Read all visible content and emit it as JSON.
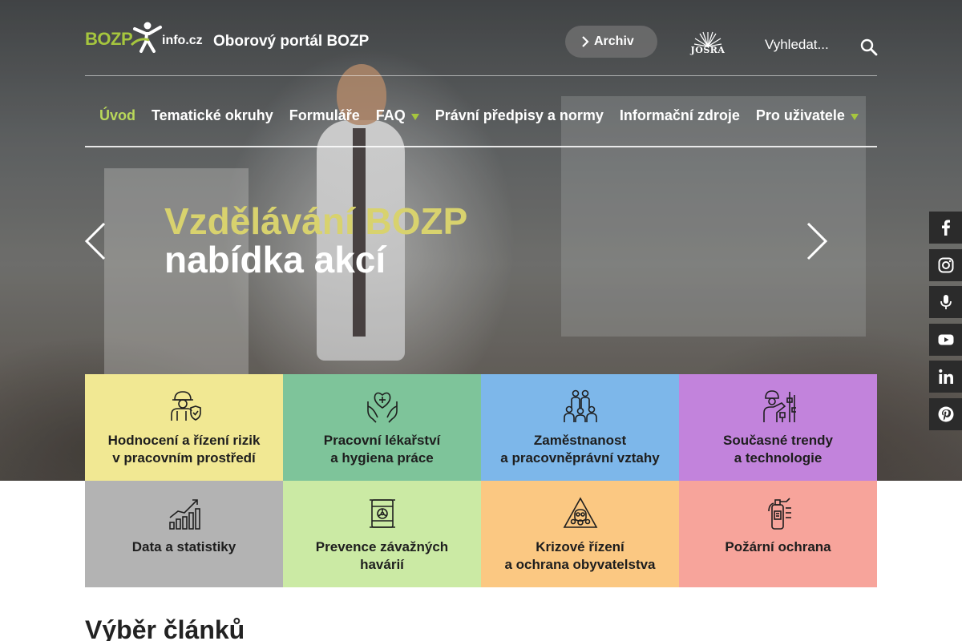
{
  "header": {
    "logo_text_main": "BOZP",
    "logo_text_domain": "info.cz",
    "portal_title": "Oborový portál BOZP",
    "archiv_label": "Archiv",
    "partner_logo_text": "JOSRA",
    "search_placeholder": "Vyhledat...",
    "accent_color": "#a6c63e"
  },
  "nav": {
    "items": [
      {
        "label": "Úvod",
        "active": true,
        "has_dropdown": false
      },
      {
        "label": "Tematické okruhy",
        "active": false,
        "has_dropdown": false
      },
      {
        "label": "Formuláře",
        "active": false,
        "has_dropdown": false
      },
      {
        "label": "FAQ",
        "active": false,
        "has_dropdown": true
      },
      {
        "label": "Právní předpisy a normy",
        "active": false,
        "has_dropdown": false
      },
      {
        "label": "Informační zdroje",
        "active": false,
        "has_dropdown": false
      },
      {
        "label": "Pro uživatele",
        "active": false,
        "has_dropdown": true
      }
    ]
  },
  "slider": {
    "title": "Vzdělávání BOZP",
    "subtitle": "nabídka akcí",
    "title_color": "#d8d26e"
  },
  "social": [
    "facebook-icon",
    "instagram-icon",
    "microphone-icon",
    "youtube-icon",
    "linkedin-icon",
    "pinterest-icon"
  ],
  "tiles": [
    {
      "label": "Hodnocení a řízení rizik\nv pracovním prostředí",
      "color": "#f1e893",
      "icon": "worker-shield-icon"
    },
    {
      "label": "Pracovní lékařství\na hygiena práce",
      "color": "#7ec49a",
      "icon": "hands-heart-icon"
    },
    {
      "label": "Zaměstnanost\na pracovněprávní vztahy",
      "color": "#7db7ea",
      "icon": "workers-group-icon"
    },
    {
      "label": "Současné trendy\na technologie",
      "color": "#c283dc",
      "icon": "robot-worker-icon"
    },
    {
      "label": "Data a statistiky",
      "color": "#b3b3b3",
      "icon": "chart-growth-icon"
    },
    {
      "label": "Prevence závažných\nhavárií",
      "color": "#cbeaa4",
      "icon": "hazard-barrel-icon"
    },
    {
      "label": "Krizové řízení\na ochrana obyvatelstva",
      "color": "#fbc882",
      "icon": "gas-mask-warning-icon"
    },
    {
      "label": "Požární ochrana",
      "color": "#f7a49b",
      "icon": "fire-extinguisher-icon"
    }
  ],
  "section": {
    "title": "Výběr článků"
  }
}
